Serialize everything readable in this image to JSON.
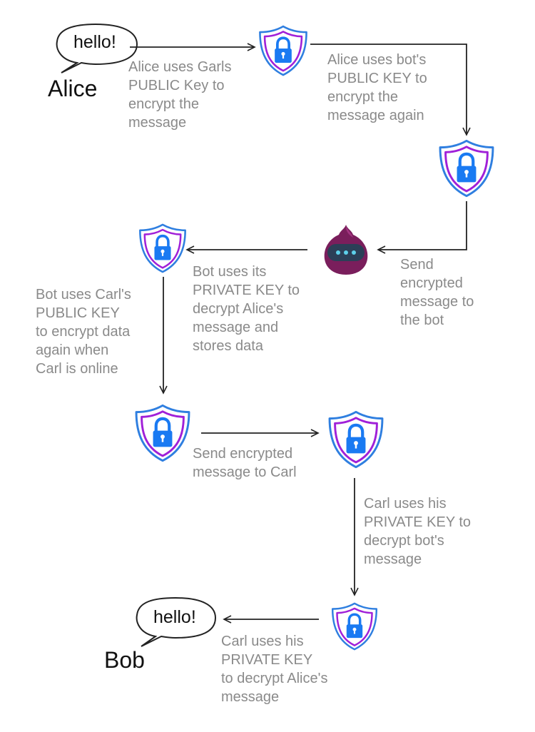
{
  "diagram": {
    "alice_bubble": "hello!",
    "alice_name": "Alice",
    "bob_bubble": "hello!",
    "bob_name": "Bob",
    "step_1": "Alice uses Garls\nPUBLIC Key to\nencrypt the\nmessage",
    "step_2": "Alice uses bot's\nPUBLIC KEY to\nencrypt the\nmessage again",
    "step_3": "Send\nencrypted\nmessage to\nthe bot",
    "step_4": "Bot uses its\nPRIVATE KEY to\ndecrypt Alice's\nmessage and\nstores data",
    "step_5": "Bot uses Carl's\nPUBLIC KEY\nto encrypt data\nagain when\nCarl is online",
    "step_6": "Send encrypted\nmessage to Carl",
    "step_7": "Carl uses his\nPRIVATE KEY to\ndecrypt bot's\nmessage",
    "step_8": "Carl uses his\nPRIVATE KEY\nto decrypt Alice's\nmessage"
  },
  "colors": {
    "outer_shield": "#2f7fe0",
    "inner_shield": "#a020d8",
    "lock": "#1a7af2",
    "bot_body": "#7a1e5c",
    "bot_visor": "#2b3f57",
    "bot_dots": "#5dd0ea",
    "caption_text": "#8a8a8a",
    "line": "#222222"
  },
  "icons": {
    "shield": "shield-lock-icon",
    "bot": "onion-bot-icon",
    "bubble": "speech-bubble-icon"
  }
}
